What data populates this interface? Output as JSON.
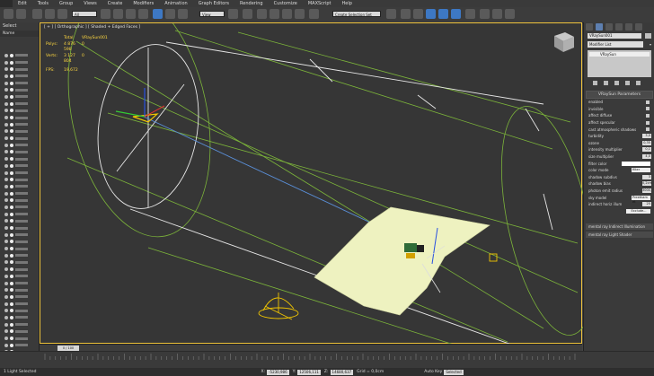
{
  "menubar": {
    "items": [
      "Edit",
      "Tools",
      "Group",
      "Views",
      "Create",
      "Modifiers",
      "Animation",
      "Graph Editors",
      "Rendering",
      "Customize",
      "MAXScript",
      "Help"
    ]
  },
  "toolbar": {
    "selection_filter": "All",
    "ref_coord": "View",
    "named_selection": "Create Selection Set"
  },
  "left_panel": {
    "header": "Select",
    "subheader": "Name",
    "row_count": 44
  },
  "viewport": {
    "label": "[ + ] [ Orthographic ] [ Shaded + Edged Faces ]",
    "stats": {
      "total_label": "Total",
      "object_name": "VRaySun001",
      "polys_label": "Polys:",
      "polys_total": "4 876 598",
      "polys_sel": "0",
      "verts_label": "Verts:",
      "verts_total": "3 127 804",
      "verts_sel": "0",
      "fps_label": "FPS:",
      "fps_value": "19,672"
    },
    "colors": {
      "wire_green": "#7cb43a",
      "wire_white": "#e6e6e6",
      "ground": "#eef2c0",
      "light_blue": "#5a8fd8",
      "gizmo_yellow": "#f2c600"
    }
  },
  "right_panel": {
    "object_name": "VRaySun001",
    "modifier_list": "Modifier List",
    "stack_entry": "VRaySun",
    "rollout_title": "VRaySun Parameters",
    "params": [
      {
        "label": "enabled",
        "kind": "check"
      },
      {
        "label": "invisible",
        "kind": "check"
      },
      {
        "label": "affect diffuse",
        "kind": "check"
      },
      {
        "label": "affect specular",
        "kind": "check"
      },
      {
        "label": "cast atmospheric shadows",
        "kind": "check"
      },
      {
        "label": "turbidity",
        "kind": "value",
        "value": "3,0"
      },
      {
        "label": "ozone",
        "kind": "value",
        "value": "0,35"
      },
      {
        "label": "intensity multiplier",
        "kind": "value",
        "value": "0,1"
      },
      {
        "label": "size multiplier",
        "kind": "value",
        "value": "4,0"
      },
      {
        "label": "filter color",
        "kind": "swatch"
      },
      {
        "label": "color mode",
        "kind": "wide",
        "value": "filter"
      },
      {
        "label": "shadow subdivs",
        "kind": "value",
        "value": "3"
      },
      {
        "label": "shadow bias",
        "kind": "value",
        "value": "0,2cm"
      },
      {
        "label": "photon emit radius",
        "kind": "value",
        "value": "3000,"
      },
      {
        "label": "sky model",
        "kind": "wide",
        "value": "Preetham et"
      },
      {
        "label": "indirect horiz illum",
        "kind": "value",
        "value": "25"
      }
    ],
    "exclude_label": "Exclude...",
    "mr_indirect": "mental ray Indirect Illumination",
    "mr_light_shader": "mental ray Light Shader"
  },
  "timeline": {
    "frame": "0 / 100"
  },
  "statusbar": {
    "selection": "1 Light Selected",
    "x_label": "X:",
    "x_value": "-5230,986",
    "y_label": "Y:",
    "y_value": "12506,111",
    "z_label": "Z:",
    "z_value": "14680,637",
    "grid": "Grid = 0,0cm",
    "auto_key": "Auto Key",
    "selected": "Selected"
  }
}
